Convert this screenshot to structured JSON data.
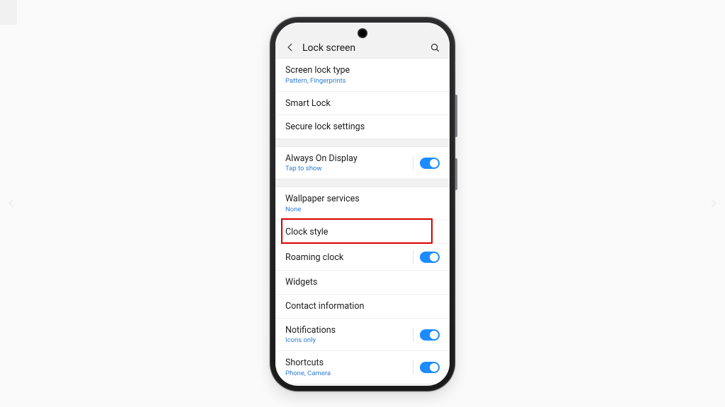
{
  "header": {
    "title": "Lock screen"
  },
  "groups": [
    {
      "rows": [
        {
          "id": "screen-lock-type",
          "title": "Screen lock type",
          "sub": "Pattern, Fingerprints"
        },
        {
          "id": "smart-lock",
          "title": "Smart Lock"
        },
        {
          "id": "secure-lock",
          "title": "Secure lock settings"
        }
      ]
    },
    {
      "rows": [
        {
          "id": "always-on-display",
          "title": "Always On Display",
          "sub": "Tap to show",
          "toggle": true
        }
      ]
    },
    {
      "rows": [
        {
          "id": "wallpaper-services",
          "title": "Wallpaper services",
          "sub": "None"
        },
        {
          "id": "clock-style",
          "title": "Clock style",
          "highlight": true
        },
        {
          "id": "roaming-clock",
          "title": "Roaming clock",
          "toggle": true
        },
        {
          "id": "widgets",
          "title": "Widgets"
        },
        {
          "id": "contact-info",
          "title": "Contact information"
        },
        {
          "id": "notifications",
          "title": "Notifications",
          "sub": "Icons only",
          "toggle": true
        },
        {
          "id": "shortcuts",
          "title": "Shortcuts",
          "sub": "Phone, Camera",
          "toggle": true
        }
      ]
    }
  ]
}
